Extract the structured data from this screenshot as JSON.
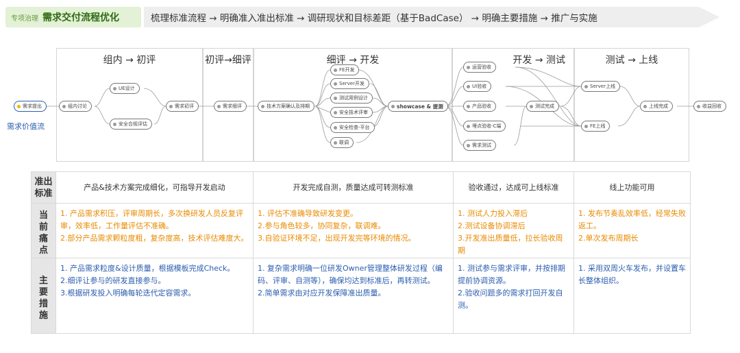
{
  "header": {
    "tag_small": "专项治理",
    "tag_title": "需求交付流程优化",
    "flow_text": "梳理标准流程 → 明确准入准出标准 → 调研现状和目标差距（基于BadCase） → 明确主要措施 → 推广与实施"
  },
  "diagram": {
    "value_stream_label": "需求价值流",
    "stages": [
      "组内 → 初评",
      "初评→细评",
      "细评 → 开发",
      "开发 → 测试",
      "测试 → 上线"
    ],
    "nodes": {
      "start": "需求提出",
      "group_discuss": "组内讨论",
      "ue_design": "UE设计",
      "security_review": "安全合规评估",
      "initial_review": "需求初评",
      "detail_review": "需求细评",
      "tech_confirm": "技术方案确认及排期",
      "fe_dev": "FE开发",
      "server_dev": "Server开发",
      "test_case": "测试用例设计",
      "tech_review": "安全技术评审",
      "security_check": "安全检查-平台",
      "joint_debug": "联调",
      "showcase": "showcase & 提测",
      "ops_accept": "运营验收",
      "ui_accept": "UI验收",
      "product_accept": "产品验收",
      "tracking_accept": "埋点验收-C端",
      "req_test": "需求测试",
      "test_done": "测试完成",
      "server_online": "Server上线",
      "fe_online": "FE上线",
      "online_done": "上线完成",
      "revenue": "收益回收"
    }
  },
  "table": {
    "row_headers": [
      "准出\n标准",
      "当前\n痛点",
      "主要\n措施"
    ],
    "exit_criteria": [
      "产品&技术方案完成细化，可指导开发启动",
      "开发完成自测，质量达成可转测标准",
      "验收通过，达成可上线标准",
      "线上功能可用"
    ],
    "pain_points": [
      [
        "1. 产品需求积压，评审周期长，多次换研发人员反复评审，效率低，工作量评估不准确。",
        "2.部分产品需求颗粒度粗，复杂度高，技术评估难度大。"
      ],
      [
        "1. 评估不准确导致研发变更。",
        "2.参与角色较多，协同复杂，联调难。",
        "3.自验证环境不足，出现开发完等环境的情况。"
      ],
      [
        "1. 测试人力投入滞后",
        "2.测试设备协调滞后",
        "3.开发准出质量低，拉长验收周期"
      ],
      [
        "1. 发布节奏乱效率低，经常失败返工。",
        "2.单次发布周期长"
      ]
    ],
    "measures": [
      [
        "1. 产品需求粒度&设计质量，根据模板完成Check。",
        "2.细评让参与的研发直接参与。",
        "3.根据研发投入明确每轮迭代定容需求。"
      ],
      [
        "1. 复杂需求明确一位研发Owner管理整体研发过程（编码、评审、自测等），确保均达到标准后，再转测试。",
        "2.简单需求由对应开发保障准出质量。"
      ],
      [
        "1. 测试参与需求评审，并按排期提前协调资源。",
        "2.验收问题多的需求打回开发自测。"
      ],
      [
        "1. 采用双周火车发布，并设置车长整体组织。"
      ]
    ]
  },
  "colors": {
    "header_tag_bg": "#e3f1d6",
    "header_tag_text": "#2f6a14",
    "pain_text": "#e88a00",
    "measure_text": "#2a5db0",
    "value_stream_text": "#2a5db0"
  }
}
